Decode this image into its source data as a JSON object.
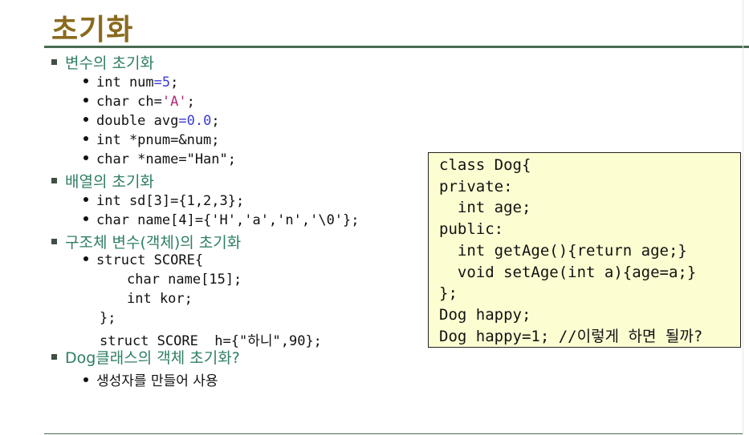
{
  "title": "초기화",
  "sections": [
    {
      "label": "변수의 초기화",
      "items": [
        {
          "pre": "int num",
          "op": "=",
          "val": "5",
          "post": ";"
        },
        {
          "pre": "char ch=",
          "op": "",
          "val": "'A'",
          "post": ";"
        },
        {
          "pre": "double avg",
          "op": "=",
          "val": "0.0",
          "post": ";"
        },
        {
          "pre": "int *pnum=&num;",
          "op": "",
          "val": "",
          "post": ""
        },
        {
          "pre": "char *name=\"Han\";",
          "op": "",
          "val": "",
          "post": ""
        }
      ]
    },
    {
      "label": "배열의 초기화",
      "items": [
        {
          "text": "int sd[3]={1,2,3};"
        },
        {
          "text": "char name[4]={'H','a','n','\\0'};"
        }
      ]
    },
    {
      "label": "구조체 변수(객체)의 초기화",
      "struct_lines": [
        "struct SCORE{",
        "char name[15];",
        "int kor;",
        "};",
        "struct SCORE  h={\"하니\",90};"
      ]
    },
    {
      "label": "Dog클래스의 객체 초기화?",
      "items": [
        {
          "text": "생성자를 만들어 사용"
        }
      ]
    }
  ],
  "code_box": [
    "class Dog{",
    "private:",
    "  int age;",
    "public:",
    "  int getAge(){return age;}",
    "  void setAge(int a){age=a;}",
    "};",
    "Dog happy;",
    "Dog happy=1; //이렇게 하면 될까?"
  ],
  "colors": {
    "title": "#8a6a1e",
    "heading": "#2f7f62",
    "rule": "#4a6b52",
    "code_bg": "#fdfdd2",
    "number": "#3b3bd6",
    "string": "#b0267a"
  }
}
